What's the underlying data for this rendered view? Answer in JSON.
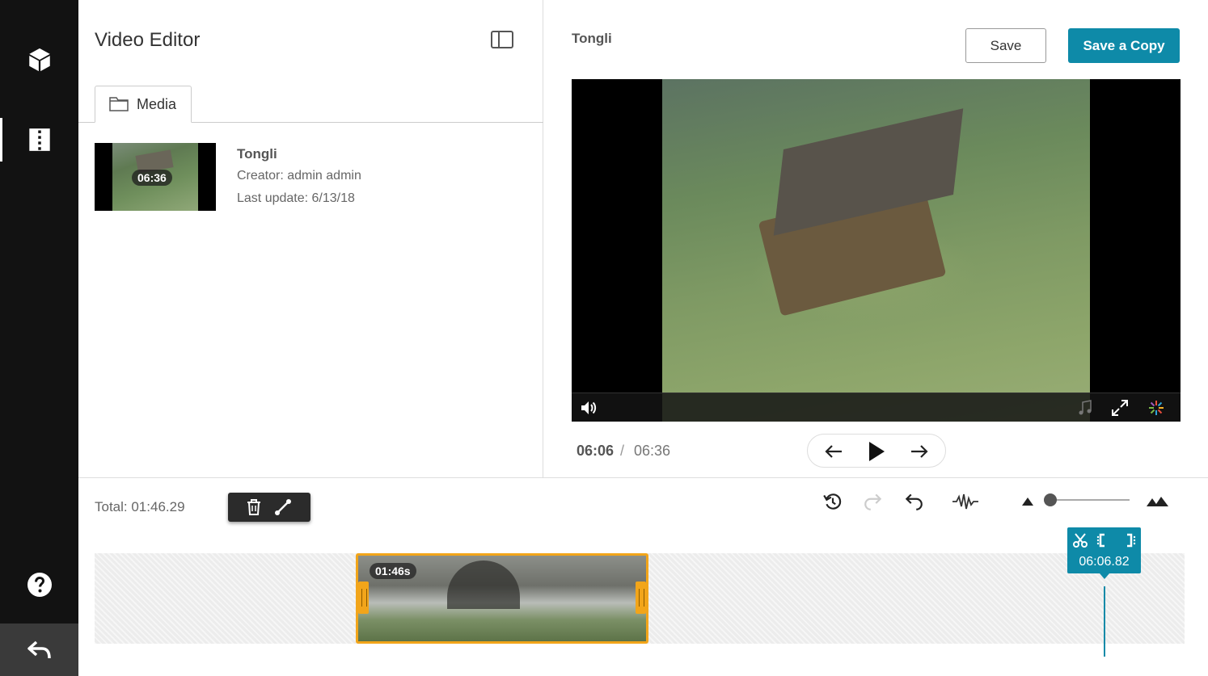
{
  "sidebar": {
    "items": [
      {
        "icon": "cube-icon",
        "active": false
      },
      {
        "icon": "editor-icon",
        "active": true
      }
    ],
    "help_icon": "help-icon",
    "back_icon": "back-icon"
  },
  "left_panel": {
    "title": "Video Editor",
    "layout_icon": "layout-toggle-icon",
    "tabs": [
      {
        "label": "Media",
        "icon": "folder-icon"
      }
    ],
    "media_items": [
      {
        "thumb_duration": "06:36",
        "name": "Tongli",
        "creator": "Creator: admin admin",
        "last_update": "Last update: 6/13/18"
      }
    ]
  },
  "preview": {
    "title": "Tongli",
    "save_label": "Save",
    "save_copy_label": "Save a Copy",
    "current_time": "06:06",
    "separator": "/",
    "total_time": "06:36"
  },
  "timeline": {
    "total_label": "Total: 01:46.29",
    "clip_duration": "01:46s",
    "playhead_time": "06:06.82",
    "accent_color": "#0e8aa8",
    "clip_color": "#f2a51a"
  }
}
